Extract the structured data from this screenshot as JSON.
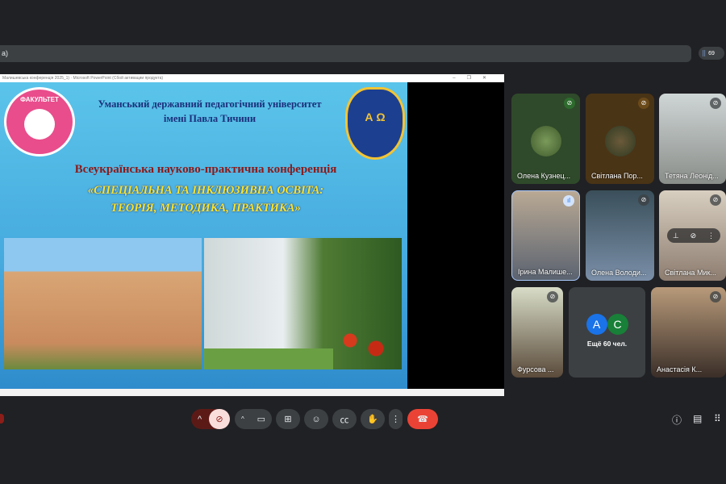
{
  "topbar": {
    "title_fragment": "a)",
    "participant_count": "69"
  },
  "shared_window": {
    "title": "Малишевська конференція 2025_1)  ·  Microsoft PowerPoint (Сбой активации продукта)",
    "controls": [
      "–",
      "❐",
      "✕"
    ]
  },
  "slide": {
    "university_line1": "Уманський державний педагогічний університет",
    "university_line2": "імені Павла Тичини",
    "faculty_logo_text": "ФАКУЛЬТЕТ",
    "uni_logo_text": "А Ω",
    "conference": "Всеукраїнська науково-практична конференція",
    "theme_line1": "«СПЕЦІАЛЬНА ТА ІНКЛЮЗИВНА ОСВІТА:",
    "theme_line2": "ТЕОРІЯ, МЕТОДИКА, ПРАКТИКА»"
  },
  "participants": [
    {
      "name": "Олена Кузнец...",
      "mic": "muted"
    },
    {
      "name": "Світлана Пор...",
      "mic": "muted"
    },
    {
      "name": "Тетяна Леонід...",
      "mic": "muted"
    },
    {
      "name": "Ірина Малише...",
      "mic": "speaking"
    },
    {
      "name": "Олена Володи...",
      "mic": "muted"
    },
    {
      "name": "Світлана Мик...",
      "mic": "muted"
    },
    {
      "name": "Фурсова ...",
      "mic": "muted"
    },
    {
      "name": "Анастасія К...",
      "mic": "muted"
    }
  ],
  "more": {
    "avatars": [
      {
        "letter": "A",
        "color": "#1a73e8"
      },
      {
        "letter": "C",
        "color": "#188038"
      }
    ],
    "label": "Ещё 60 чел."
  },
  "controls": {
    "mic_muted": true,
    "colors": {
      "hangup": "#ea4335",
      "mic_bg": "#f9dedc"
    }
  }
}
